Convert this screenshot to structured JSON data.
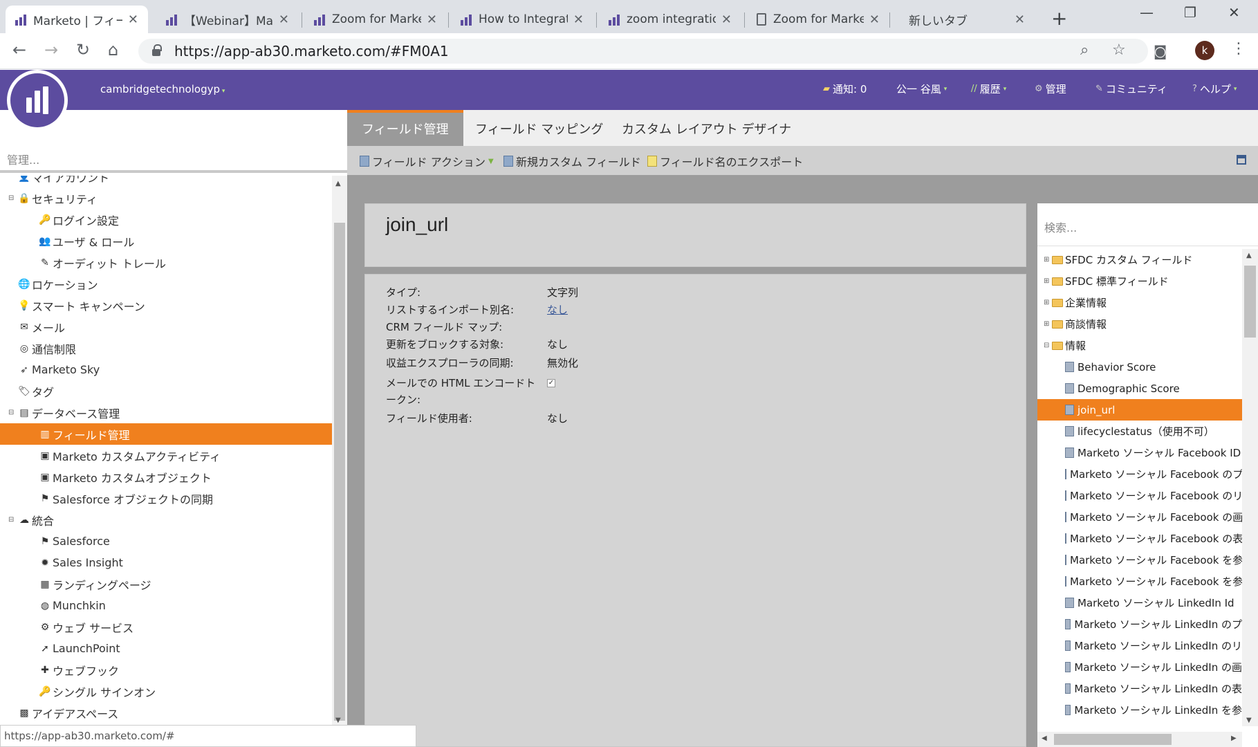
{
  "browser": {
    "tabs": [
      {
        "title": "Marketo | フィール",
        "icon": "marketo-icon",
        "active": true
      },
      {
        "title": "【Webinar】Marke",
        "icon": "marketo-icon",
        "active": false
      },
      {
        "title": "Zoom for Marke",
        "icon": "marketo-icon",
        "active": false
      },
      {
        "title": "How to Integrat",
        "icon": "marketo-icon",
        "active": false
      },
      {
        "title": "zoom integratio",
        "icon": "marketo-icon",
        "active": false
      },
      {
        "title": "Zoom for Marke",
        "icon": "page-icon",
        "active": false
      },
      {
        "title": "新しいタブ",
        "icon": "none",
        "active": false
      }
    ],
    "url": "https://app-ab30.marketo.com/#FM0A1",
    "profile_initial": "k",
    "status_url": "https://app-ab30.marketo.com/#"
  },
  "header": {
    "tenant": "cambridgetechnologyp",
    "notifications": "通知: 0",
    "user": "公一 谷風",
    "history": "履歴",
    "admin": "管理",
    "community": "コミュニティ",
    "help": "ヘルプ"
  },
  "left_panel": {
    "search_placeholder": "管理...",
    "items": [
      {
        "label": "マイアカウント",
        "level": 1,
        "icon": "user-icon"
      },
      {
        "label": "セキュリティ",
        "level": 1,
        "icon": "lock-icon",
        "expander": "⊟"
      },
      {
        "label": "ログイン設定",
        "level": 2,
        "icon": "key-icon"
      },
      {
        "label": "ユーザ & ロール",
        "level": 2,
        "icon": "users-icon"
      },
      {
        "label": "オーディット トレール",
        "level": 2,
        "icon": "audit-icon"
      },
      {
        "label": "ロケーション",
        "level": 1,
        "icon": "globe-icon"
      },
      {
        "label": "スマート キャンペーン",
        "level": 1,
        "icon": "bulb-icon"
      },
      {
        "label": "メール",
        "level": 1,
        "icon": "mail-icon"
      },
      {
        "label": "通信制限",
        "level": 1,
        "icon": "limit-icon"
      },
      {
        "label": "Marketo Sky",
        "level": 1,
        "icon": "bird-icon"
      },
      {
        "label": "タグ",
        "level": 1,
        "icon": "tag-icon"
      },
      {
        "label": "データベース管理",
        "level": 1,
        "icon": "database-icon",
        "expander": "⊟"
      },
      {
        "label": "フィールド管理",
        "level": 2,
        "icon": "field-icon",
        "selected": true
      },
      {
        "label": "Marketo カスタムアクティビティ",
        "level": 2,
        "icon": "activity-icon"
      },
      {
        "label": "Marketo カスタムオブジェクト",
        "level": 2,
        "icon": "object-icon"
      },
      {
        "label": "Salesforce オブジェクトの同期",
        "level": 2,
        "icon": "salesforce-icon"
      },
      {
        "label": "統合",
        "level": 1,
        "icon": "cloud-icon",
        "expander": "⊟"
      },
      {
        "label": "Salesforce",
        "level": 2,
        "icon": "salesforce-icon"
      },
      {
        "label": "Sales Insight",
        "level": 2,
        "icon": "fire-icon"
      },
      {
        "label": "ランディングページ",
        "level": 2,
        "icon": "landing-page-icon"
      },
      {
        "label": "Munchkin",
        "level": 2,
        "icon": "munchkin-icon"
      },
      {
        "label": "ウェブ サービス",
        "level": 2,
        "icon": "web-service-icon"
      },
      {
        "label": "LaunchPoint",
        "level": 2,
        "icon": "rocket-icon"
      },
      {
        "label": "ウェブフック",
        "level": 2,
        "icon": "webhook-icon"
      },
      {
        "label": "シングル サインオン",
        "level": 2,
        "icon": "sso-icon"
      },
      {
        "label": "アイデアスペース",
        "level": 1,
        "icon": "ideas-icon"
      }
    ]
  },
  "main": {
    "tabs": [
      "フィールド管理",
      "フィールド マッピング",
      "カスタム レイアウト デザイナ"
    ],
    "toolbar": {
      "field_actions": "フィールド アクション",
      "new_custom_field": "新規カスタム フィールド",
      "export_field_names": "フィールド名のエクスポート"
    },
    "field_name": "join_url",
    "properties": [
      {
        "label": "タイプ:",
        "value": "文字列"
      },
      {
        "label": "リストするインポート別名:",
        "value": "なし",
        "link": true
      },
      {
        "label": "CRM フィールド マップ:",
        "value": ""
      },
      {
        "label": "更新をブロックする対象:",
        "value": "なし"
      },
      {
        "label": "収益エクスプローラの同期:",
        "value": "無効化"
      },
      {
        "label": "メールでの HTML エンコードトークン:",
        "value": "",
        "checkbox": true
      },
      {
        "label": "フィールド使用者:",
        "value": "なし"
      }
    ]
  },
  "right_panel": {
    "search_placeholder": "検索...",
    "items": [
      {
        "label": "SFDC カスタム フィールド",
        "type": "folder",
        "expander": "⊞"
      },
      {
        "label": "SFDC 標準フィールド",
        "type": "folder",
        "expander": "⊞"
      },
      {
        "label": "企業情報",
        "type": "folder",
        "expander": "⊞"
      },
      {
        "label": "商談情報",
        "type": "folder",
        "expander": "⊞"
      },
      {
        "label": "情報",
        "type": "folder",
        "expander": "⊟"
      },
      {
        "label": "Behavior Score",
        "type": "field"
      },
      {
        "label": "Demographic Score",
        "type": "field"
      },
      {
        "label": "join_url",
        "type": "field",
        "selected": true
      },
      {
        "label": "lifecyclestatus（使用不可）",
        "type": "field"
      },
      {
        "label": "Marketo ソーシャル Facebook ID",
        "type": "field"
      },
      {
        "label": "Marketo ソーシャル Facebook のプ",
        "type": "field"
      },
      {
        "label": "Marketo ソーシャル Facebook のリ",
        "type": "field"
      },
      {
        "label": "Marketo ソーシャル Facebook の画",
        "type": "field"
      },
      {
        "label": "Marketo ソーシャル Facebook の表",
        "type": "field"
      },
      {
        "label": "Marketo ソーシャル Facebook を参",
        "type": "field"
      },
      {
        "label": "Marketo ソーシャル Facebook を参",
        "type": "field"
      },
      {
        "label": "Marketo ソーシャル LinkedIn Id",
        "type": "field"
      },
      {
        "label": "Marketo ソーシャル LinkedIn のプ",
        "type": "field"
      },
      {
        "label": "Marketo ソーシャル LinkedIn のリ",
        "type": "field"
      },
      {
        "label": "Marketo ソーシャル LinkedIn の画",
        "type": "field"
      },
      {
        "label": "Marketo ソーシャル LinkedIn の表",
        "type": "field"
      },
      {
        "label": "Marketo ソーシャル LinkedIn を参",
        "type": "field"
      }
    ]
  },
  "colors": {
    "brand_purple": "#5c4c9f",
    "selection_orange": "#f0801e"
  }
}
